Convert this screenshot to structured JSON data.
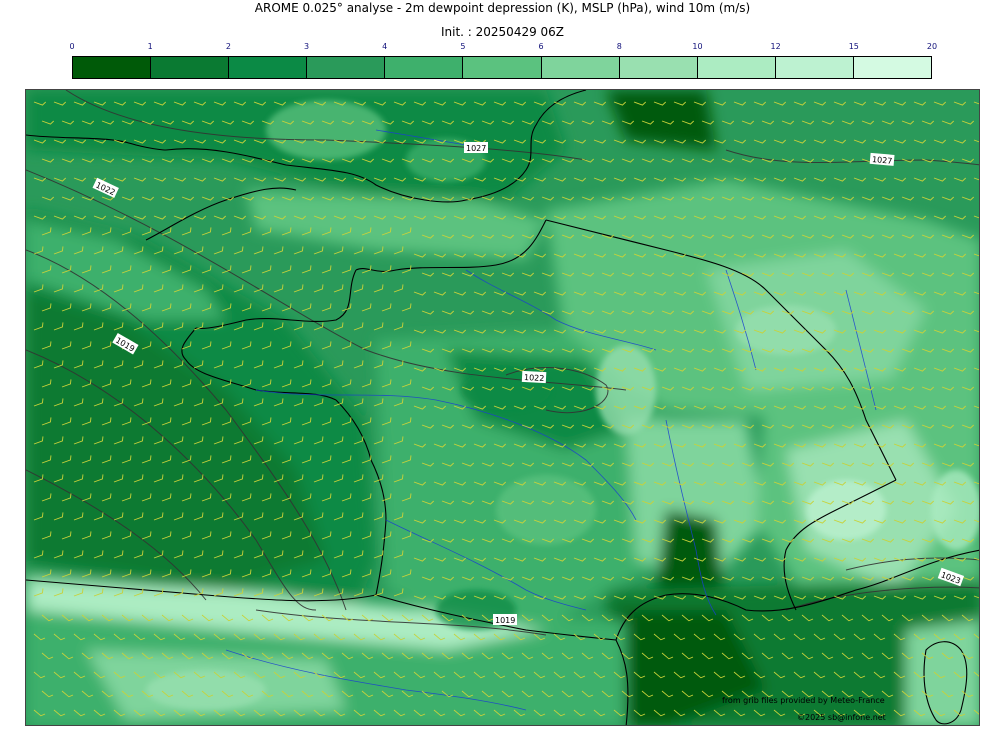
{
  "title": "AROME 0.025° analyse - 2m dewpoint depression (K), MSLP (hPa), wind 10m (m/s)",
  "init": "Init. : 20250429 06Z",
  "colorbar": {
    "ticks": [
      "0",
      "1",
      "2",
      "3",
      "4",
      "5",
      "6",
      "8",
      "10",
      "12",
      "15",
      "20"
    ],
    "colors": [
      "#005a08",
      "#0a7a32",
      "#0b8a45",
      "#2a9a5a",
      "#3eb06c",
      "#5bc27f",
      "#7fd49c",
      "#99e0b0",
      "#acecc2",
      "#bdf2d1",
      "#d4fae2"
    ]
  },
  "isobar_labels": [
    {
      "text": "1027"
    },
    {
      "text": "1022"
    },
    {
      "text": "1027"
    },
    {
      "text": "1019"
    },
    {
      "text": "1022"
    },
    {
      "text": "1019"
    },
    {
      "text": "1023"
    }
  ],
  "credits": {
    "line1": "from grib files provided by Meteo-France",
    "line2": "©2025 sb@infone.net"
  },
  "colors": {
    "coastline": "#000000",
    "rivers": "#1a3fd0",
    "isobars": "#333333",
    "wind_barbs": "#c8d23a"
  }
}
